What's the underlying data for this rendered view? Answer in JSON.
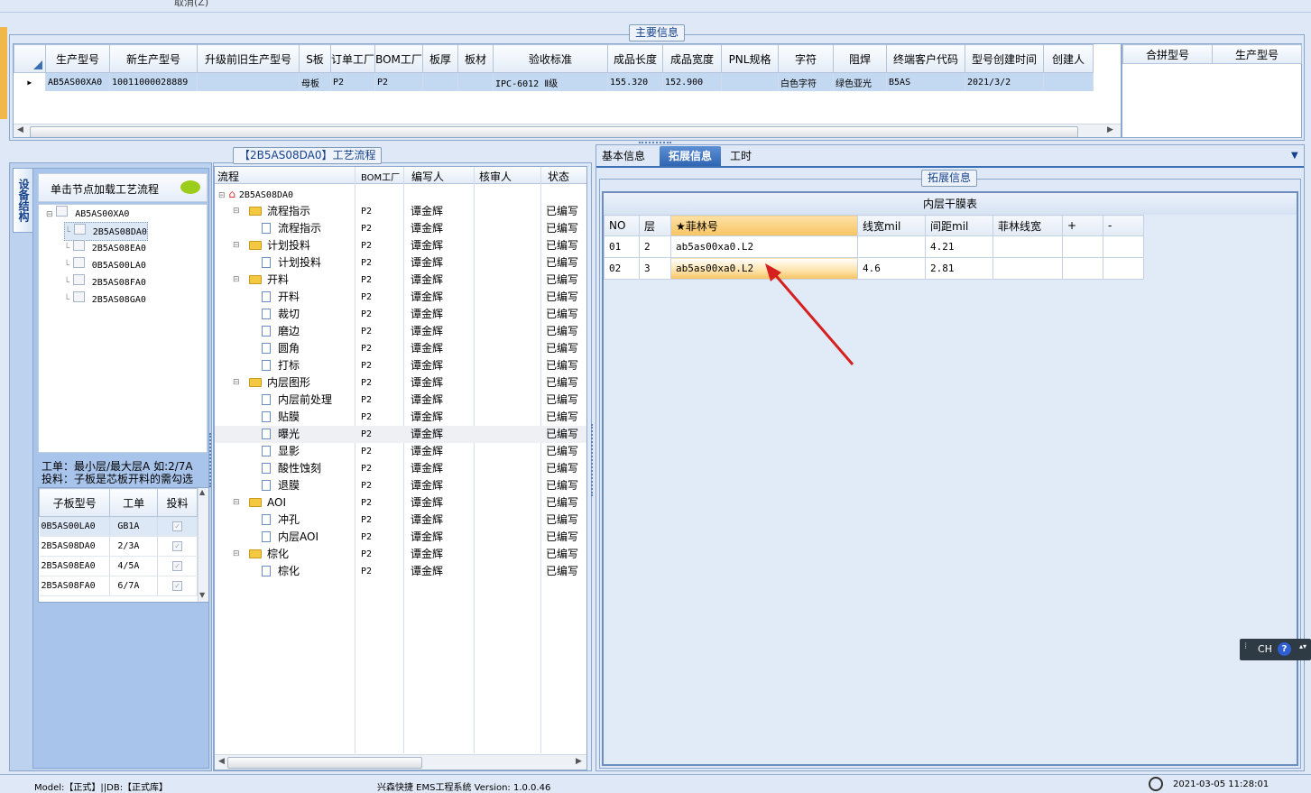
{
  "toolbar": {
    "cancel_label": "取消(Z)"
  },
  "main_info": {
    "caption": "主要信息",
    "columns": [
      "生产型号",
      "新生产型号",
      "升级前旧生产型号",
      "S板",
      "订单工厂",
      "BOM工厂",
      "板厚",
      "板材",
      "验收标准",
      "成品长度",
      "成品宽度",
      "PNL规格",
      "字符",
      "阻焊",
      "终端客户代码",
      "型号创建时间",
      "创建人"
    ],
    "row": [
      "AB5AS00XA0",
      "10011000028889",
      "",
      "母板",
      "P2",
      "P2",
      "",
      "",
      "IPC-6012 Ⅱ级",
      "155.320",
      "152.900",
      "",
      "白色字符",
      "绿色亚光",
      "B5AS",
      "2021/3/2",
      ""
    ],
    "side_columns": [
      "合拼型号",
      "生产型号"
    ]
  },
  "left": {
    "vertical_tab": "设备结构",
    "hint": "单击节点加载工艺流程",
    "tree_root": "AB5AS00XA0",
    "tree_children": [
      "2B5AS08DA0",
      "2B5AS08EA0",
      "0B5AS00LA0",
      "2B5AS08FA0",
      "2B5AS08GA0"
    ],
    "note_line1": "工单：最小层/最大层A 如:2/7A",
    "note_line2": "投料：子板是芯板开料的需勾选",
    "sub_columns": [
      "子板型号",
      "工单",
      "投料"
    ],
    "sub_rows": [
      {
        "model": "0B5AS00LA0",
        "order": "GB1A"
      },
      {
        "model": "2B5AS08DA0",
        "order": "2/3A"
      },
      {
        "model": "2B5AS08EA0",
        "order": "4/5A"
      },
      {
        "model": "2B5AS08FA0",
        "order": "6/7A"
      }
    ]
  },
  "flow": {
    "caption": "【2B5AS08DA0】工艺流程",
    "columns": [
      "流程",
      "BOM工厂",
      "编写人",
      "核审人",
      "状态"
    ],
    "root": "2B5AS08DA0",
    "rows": [
      {
        "level": 1,
        "kind": "folder",
        "name": "流程指示"
      },
      {
        "level": 2,
        "kind": "doc",
        "name": "流程指示"
      },
      {
        "level": 1,
        "kind": "folder",
        "name": "计划投料"
      },
      {
        "level": 2,
        "kind": "doc",
        "name": "计划投料"
      },
      {
        "level": 1,
        "kind": "folder",
        "name": "开料"
      },
      {
        "level": 2,
        "kind": "doc",
        "name": "开料"
      },
      {
        "level": 2,
        "kind": "doc",
        "name": "裁切"
      },
      {
        "level": 2,
        "kind": "doc",
        "name": "磨边"
      },
      {
        "level": 2,
        "kind": "doc",
        "name": "圆角"
      },
      {
        "level": 2,
        "kind": "doc",
        "name": "打标"
      },
      {
        "level": 1,
        "kind": "folder",
        "name": "内层图形"
      },
      {
        "level": 2,
        "kind": "doc",
        "name": "内层前处理"
      },
      {
        "level": 2,
        "kind": "doc",
        "name": "贴膜"
      },
      {
        "level": 2,
        "kind": "doc",
        "name": "曝光"
      },
      {
        "level": 2,
        "kind": "doc",
        "name": "显影"
      },
      {
        "level": 2,
        "kind": "doc",
        "name": "酸性蚀刻"
      },
      {
        "level": 2,
        "kind": "doc",
        "name": "退膜"
      },
      {
        "level": 1,
        "kind": "folder",
        "name": "AOI"
      },
      {
        "level": 2,
        "kind": "doc",
        "name": "冲孔"
      },
      {
        "level": 2,
        "kind": "doc",
        "name": "内层AOI"
      },
      {
        "level": 1,
        "kind": "folder",
        "name": "棕化"
      },
      {
        "level": 2,
        "kind": "doc",
        "name": "棕化"
      }
    ],
    "bom": "P2",
    "writer": "谭金辉",
    "status": "已编写"
  },
  "right": {
    "tabs": [
      "基本信息",
      "拓展信息",
      "工时"
    ],
    "active_tab": 1,
    "group_caption": "拓展信息",
    "table_title": "内层干膜表",
    "columns": [
      "NO",
      "层",
      "★菲林号",
      "线宽mil",
      "间距mil",
      "菲林线宽",
      "+",
      "-"
    ],
    "rows": [
      [
        "01",
        "2",
        "ab5as00xa0.L2",
        "",
        "4.21",
        ""
      ],
      [
        "02",
        "3",
        "ab5as00xa0.L2",
        "4.6",
        "2.81",
        ""
      ]
    ]
  },
  "ime": {
    "label": "CH"
  },
  "status": {
    "left": "Model:【正式】||DB:【正式库】",
    "center": "兴森快捷 EMS工程系统 Version: 1.0.0.46",
    "right": "2021-03-05 11:28:01"
  }
}
